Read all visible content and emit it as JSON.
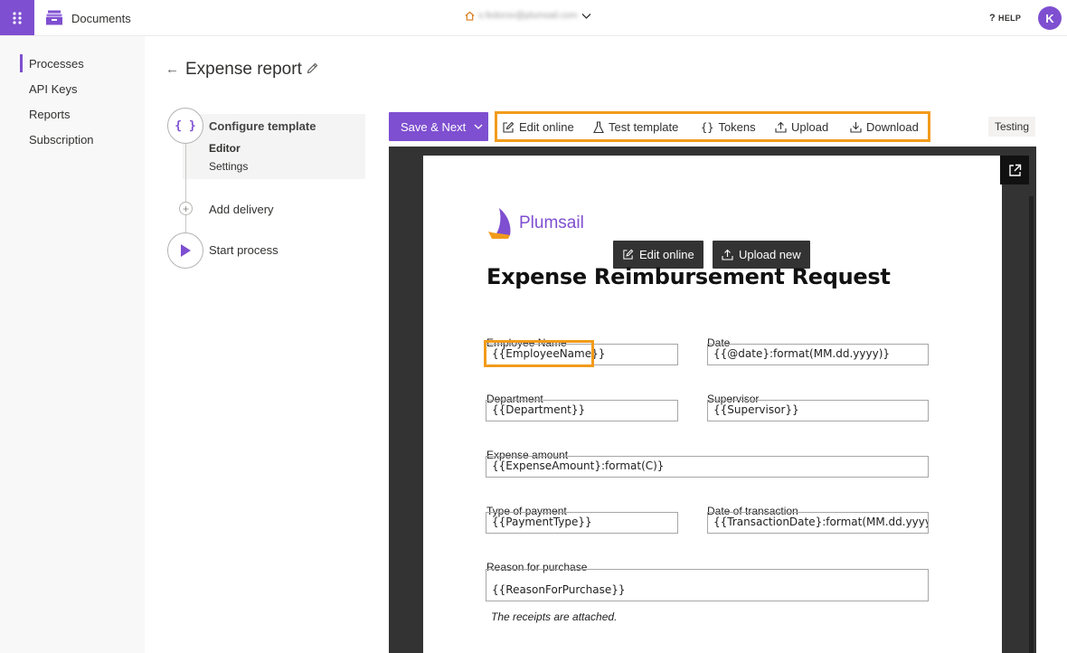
{
  "topbar": {
    "app_title": "Documents",
    "account_email": "s.fedorov@plumsail.com",
    "help_label": "HELP",
    "help_glyph": "?",
    "avatar_initial": "K",
    "brand_color": "#7e4fd0"
  },
  "nav": {
    "items": [
      {
        "label": "Processes",
        "active": true
      },
      {
        "label": "API Keys",
        "active": false
      },
      {
        "label": "Reports",
        "active": false
      },
      {
        "label": "Subscription",
        "active": false
      }
    ]
  },
  "page": {
    "back_glyph": "←",
    "title": "Expense report"
  },
  "steps": {
    "configure": {
      "label": "Configure template",
      "glyph": "{ }",
      "sub_editor": "Editor",
      "sub_settings": "Settings"
    },
    "delivery": {
      "label": "Add delivery",
      "glyph": "+"
    },
    "start": {
      "label": "Start process"
    }
  },
  "toolbar": {
    "save_label": "Save & Next",
    "edit_online": "Edit online",
    "test_template": "Test template",
    "tokens": "Tokens",
    "upload": "Upload",
    "download": "Download",
    "testing_badge": "Testing",
    "highlight_color": "#f29b1b"
  },
  "preview": {
    "logo_text": "Plumsail",
    "overlay_edit": "Edit online",
    "overlay_upload": "Upload new",
    "doc_title": "Expense Reimbursement Request",
    "fields": {
      "employee_name": {
        "label": "Employee Name",
        "value": "{{EmployeeName}}"
      },
      "date": {
        "label": "Date",
        "value": "{{@date}:format(MM.dd.yyyy)}"
      },
      "department": {
        "label": "Department",
        "value": "{{Department}}"
      },
      "supervisor": {
        "label": "Supervisor",
        "value": "{{Supervisor}}"
      },
      "expense_amount": {
        "label": "Expense amount",
        "value": "{{ExpenseAmount}:format(C)}"
      },
      "type_of_payment": {
        "label": "Type of payment",
        "value": "{{PaymentType}}"
      },
      "date_of_transaction": {
        "label": "Date of transaction",
        "value": "{{TransactionDate}:format(MM.dd.yyyy)}"
      },
      "reason": {
        "label": "Reason for purchase",
        "value": "{{ReasonForPurchase}}"
      }
    },
    "note": "The receipts are attached."
  }
}
